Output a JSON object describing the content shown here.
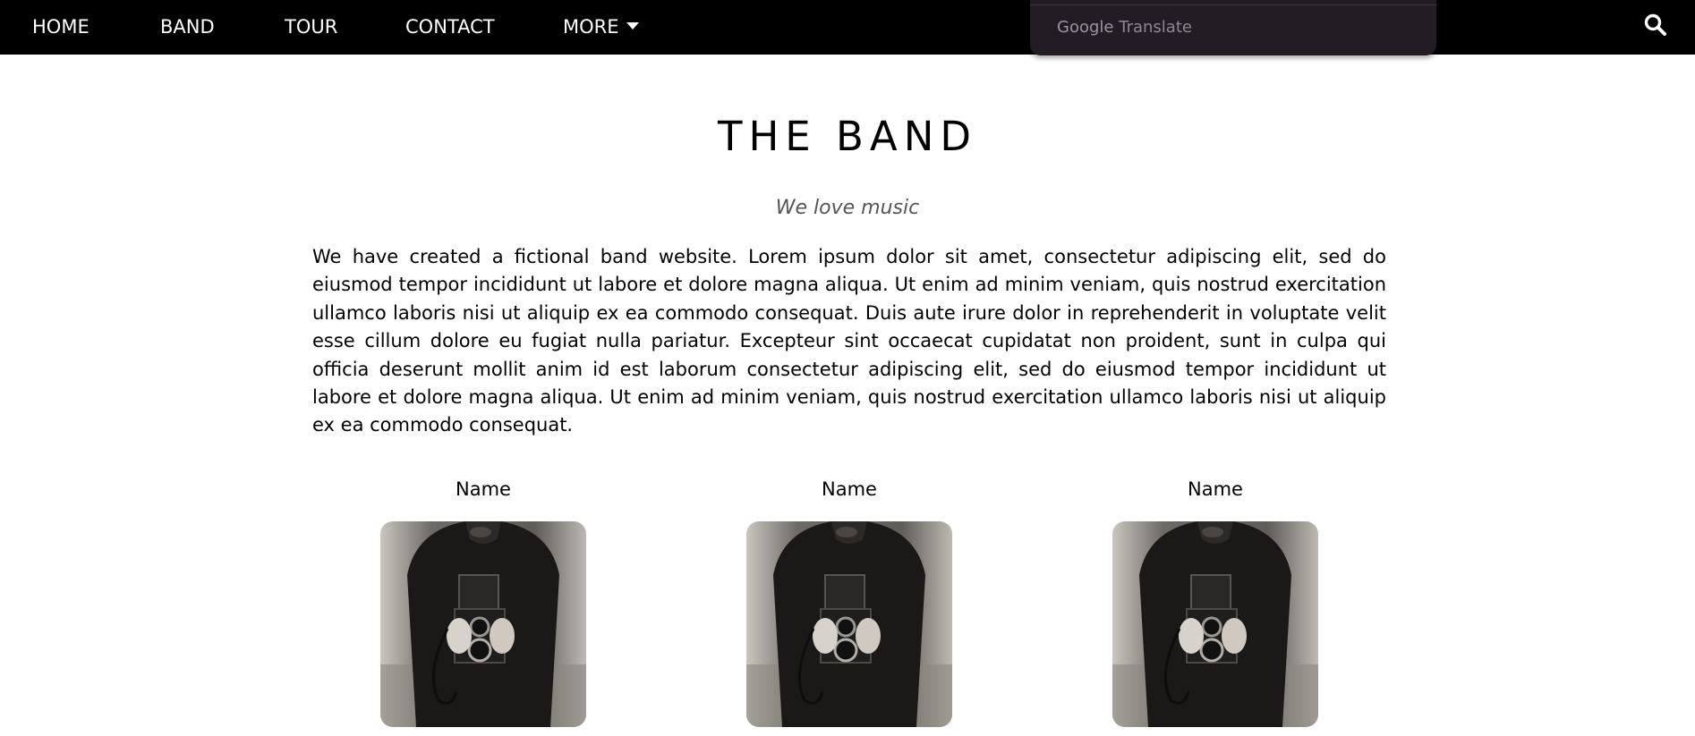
{
  "nav": {
    "items": [
      {
        "label": "HOME"
      },
      {
        "label": "BAND"
      },
      {
        "label": "TOUR"
      },
      {
        "label": "CONTACT"
      },
      {
        "label": "MORE"
      }
    ],
    "search_icon": "search-icon"
  },
  "translate": {
    "brand": "Google",
    "label": "Translate"
  },
  "band": {
    "title": "THE BAND",
    "subtitle": "We love music",
    "description": "We have created a fictional band website. Lorem ipsum dolor sit amet, consectetur adipiscing elit, sed do eiusmod tempor incididunt ut labore et dolore magna aliqua. Ut enim ad minim veniam, quis nostrud exercitation ullamco laboris nisi ut aliquip ex ea commodo consequat. Duis aute irure dolor in reprehenderit in voluptate velit esse cillum dolore eu fugiat nulla pariatur. Excepteur sint occaecat cupidatat non proident, sunt in culpa qui officia deserunt mollit anim id est laborum consectetur adipiscing elit, sed do eiusmod tempor incididunt ut labore et dolore magna aliqua. Ut enim ad minim veniam, quis nostrud exercitation ullamco laboris nisi ut aliquip ex ea commodo consequat.",
    "members": [
      {
        "name": "Name"
      },
      {
        "name": "Name"
      },
      {
        "name": "Name"
      }
    ]
  },
  "colors": {
    "nav_bg": "#000000",
    "nav_text": "#ffffff",
    "translate_bg": "#221d24"
  }
}
